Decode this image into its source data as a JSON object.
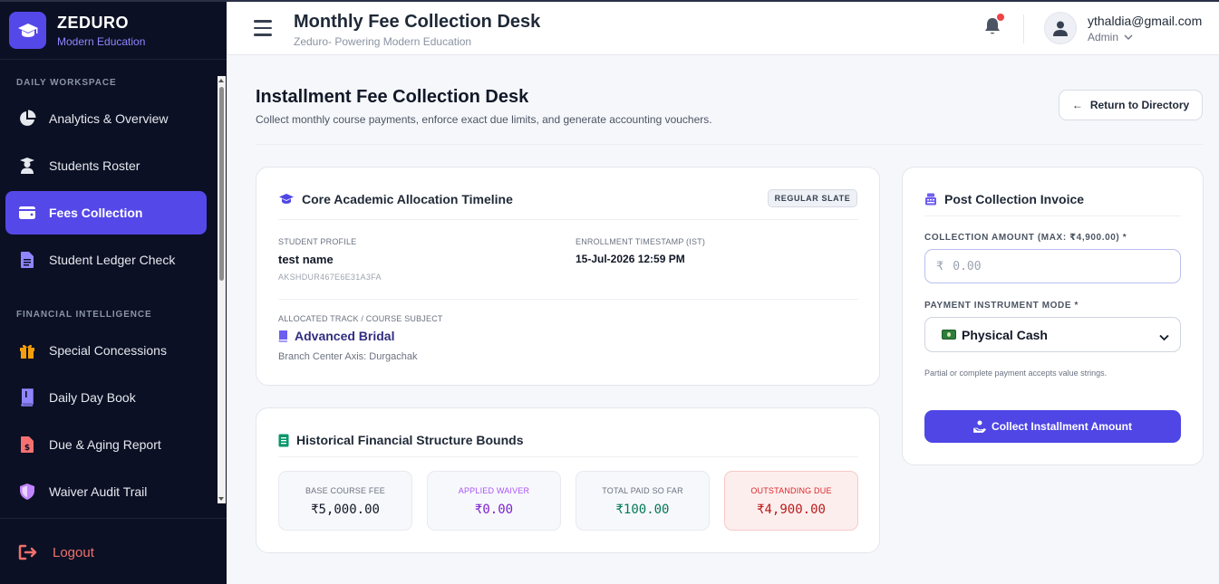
{
  "brand": {
    "name": "ZEDURO",
    "tagline": "Modern Education"
  },
  "sidebar": {
    "sections": [
      {
        "label": "DAILY WORKSPACE"
      },
      {
        "label": "FINANCIAL INTELLIGENCE"
      }
    ],
    "items": [
      {
        "label": "Analytics & Overview",
        "icon": "pie-chart-icon"
      },
      {
        "label": "Students Roster",
        "icon": "student-icon"
      },
      {
        "label": "Fees Collection",
        "icon": "wallet-icon",
        "active": true
      },
      {
        "label": "Student Ledger Check",
        "icon": "document-icon"
      },
      {
        "label": "Special Concessions",
        "icon": "gift-icon"
      },
      {
        "label": "Daily Day Book",
        "icon": "book-icon"
      },
      {
        "label": "Due & Aging Report",
        "icon": "invoice-icon"
      },
      {
        "label": "Waiver Audit Trail",
        "icon": "shield-icon"
      }
    ],
    "logout": "Logout"
  },
  "header": {
    "title": "Monthly Fee Collection Desk",
    "subtitle": "Zeduro- Powering Modern Education",
    "user": {
      "email": "ythaldia@gmail.com",
      "role": "Admin"
    }
  },
  "page": {
    "title": "Installment Fee Collection Desk",
    "description": "Collect monthly course payments, enforce exact due limits, and generate accounting vouchers.",
    "return_button": "Return to Directory"
  },
  "allocation": {
    "title": "Core Academic Allocation Timeline",
    "badge": "REGULAR SLATE",
    "student_label": "STUDENT PROFILE",
    "student_name": "test name",
    "student_id": "AKSHDUR467E6E31A3FA",
    "enrollment_label": "ENROLLMENT TIMESTAMP (IST)",
    "enrollment_value": "15-Jul-2026 12:59 PM",
    "track_label": "ALLOCATED TRACK / COURSE SUBJECT",
    "course": "Advanced Bridal",
    "branch": "Branch Center Axis: Durgachak"
  },
  "history": {
    "title": "Historical Financial Structure Bounds",
    "stats": [
      {
        "label": "BASE COURSE FEE",
        "value": "₹5,000.00",
        "color": "#111827",
        "label_color": "#6b7280"
      },
      {
        "label": "APPLIED WAIVER",
        "value": "₹0.00",
        "color": "#7e22ce",
        "label_color": "#a855f7"
      },
      {
        "label": "TOTAL PAID SO FAR",
        "value": "₹100.00",
        "color": "#047857",
        "label_color": "#6b7280"
      },
      {
        "label": "OUTSTANDING DUE",
        "value": "₹4,900.00",
        "color": "#b91c1c",
        "label_color": "#dc2626"
      }
    ]
  },
  "invoice": {
    "title": "Post Collection Invoice",
    "amount_label": "COLLECTION AMOUNT (MAX: ₹4,900.00) *",
    "currency_symbol": "₹",
    "amount_placeholder": "0.00",
    "amount_value": "",
    "mode_label": "PAYMENT INSTRUMENT MODE *",
    "mode_selected": "Physical Cash",
    "hint": "Partial or complete payment accepts value strings.",
    "submit": "Collect Installment Amount"
  },
  "colors": {
    "accent": "#5548e8",
    "sidebar_bg": "#0b1024",
    "danger": "#ef4444"
  }
}
